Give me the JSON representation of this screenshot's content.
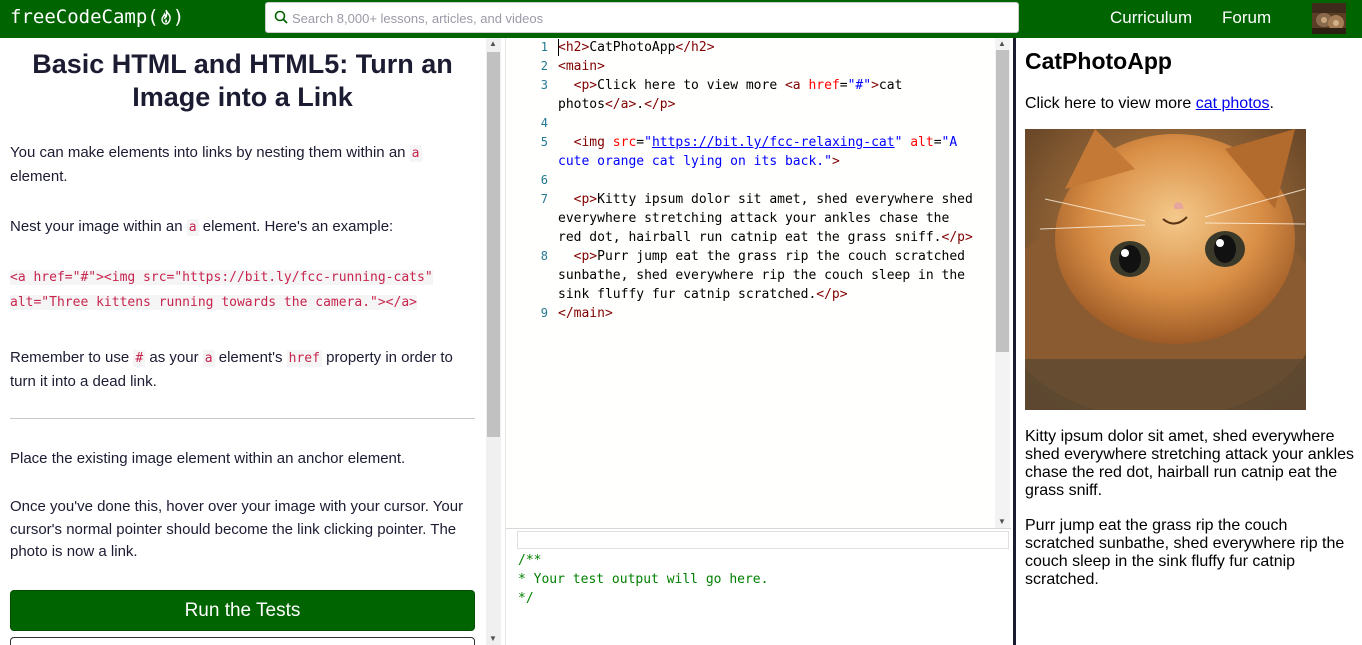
{
  "nav": {
    "logo_text": "freeCodeCamp(",
    "logo_close": ")",
    "search_placeholder": "Search 8,000+ lessons, articles, and videos",
    "links": [
      "Curriculum",
      "Forum"
    ]
  },
  "challenge": {
    "title": "Basic HTML and HTML5: Turn an Image into a Link",
    "p1_before": "You can make elements into links by nesting them within an ",
    "p1_code": "a",
    "p1_after": " element.",
    "p2_before": "Nest your image within an ",
    "p2_code": "a",
    "p2_after": " element. Here's an example:",
    "example_line1": "<a href=\"#\"><img src=\"https://bit.ly/fcc-running-cats\"",
    "example_line2": "alt=\"Three kittens running towards the camera.\"></a>",
    "p3_a": "Remember to use ",
    "p3_code1": "#",
    "p3_b": " as your ",
    "p3_code2": "a",
    "p3_c": " element's ",
    "p3_code3": "href",
    "p3_d": " property in order to turn it into a dead link.",
    "instructions_1": "Place the existing image element within an anchor element.",
    "instructions_2": "Once you've done this, hover over your image with your cursor. Your cursor's normal pointer should become the link clicking pointer. The photo is now a link.",
    "run_button": "Run the Tests"
  },
  "editor": {
    "line_numbers": [
      "1",
      "2",
      "3",
      "4",
      "5",
      "6",
      "7",
      "8",
      "9"
    ],
    "l1": {
      "t1": "<h2>",
      "text": "CatPhotoApp",
      "t2": "</h2>"
    },
    "l2": {
      "t1": "<main>"
    },
    "l3a": {
      "indent": "  ",
      "t1": "<p>",
      "text": "Click here to view more ",
      "t2": "<a ",
      "a1": "href",
      "eq": "=",
      "v1": "\"#\"",
      "t3": ">",
      "text2": "cat"
    },
    "l3b": {
      "text": "photos",
      "t1": "</a>",
      "text2": ".",
      "t2": "</p>"
    },
    "l5a": {
      "indent": "  ",
      "t1": "<img ",
      "a1": "src",
      "eq": "=",
      "q1": "\"",
      "link": "https://bit.ly/fcc-relaxing-cat",
      "q2": "\"",
      "a2": " alt",
      "eq2": "=",
      "v2": "\"A"
    },
    "l5b": {
      "v": "cute orange cat lying on its back.\"",
      "t1": ">"
    },
    "l7a": {
      "indent": "  ",
      "t1": "<p>",
      "text": "Kitty ipsum dolor sit amet, shed everywhere shed"
    },
    "l7b": {
      "text": "everywhere stretching attack your ankles chase the"
    },
    "l7c": {
      "text": "red dot, hairball run catnip eat the grass sniff.",
      "t1": "</p>"
    },
    "l8a": {
      "indent": "  ",
      "t1": "<p>",
      "text": "Purr jump eat the grass rip the couch scratched"
    },
    "l8b": {
      "text": "sunbathe, shed everywhere rip the couch sleep in the"
    },
    "l8c": {
      "text": "sink fluffy fur catnip scratched.",
      "t1": "</p>"
    },
    "l9": {
      "t1": "</main>"
    }
  },
  "output": {
    "line1": "/**",
    "line2": "* Your test output will go here.",
    "line3": "*/"
  },
  "preview": {
    "heading": "CatPhotoApp",
    "p1_text": "Click here to view more ",
    "p1_link": "cat photos",
    "p1_end": ".",
    "p2": "Kitty ipsum dolor sit amet, shed everywhere shed everywhere stretching attack your ankles chase the red dot, hairball run catnip eat the grass sniff.",
    "p3": "Purr jump eat the grass rip the couch scratched sunbathe, shed everywhere rip the couch sleep in the sink fluffy fur catnip scratched."
  },
  "colors": {
    "nav_bg": "#006400",
    "tag": "#800000",
    "attr": "#ff0000",
    "value": "#0000ff",
    "comment": "#008000",
    "inline_code": "#c7254e"
  }
}
